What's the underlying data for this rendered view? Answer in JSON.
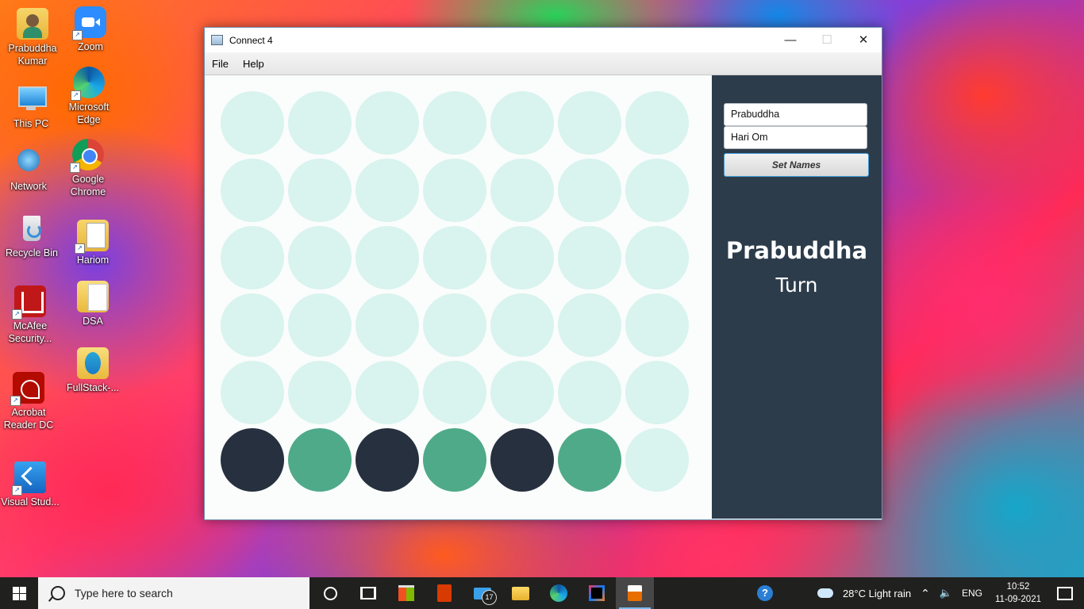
{
  "desktop": {
    "icons": [
      {
        "label": "Prabuddha Kumar"
      },
      {
        "label": "Zoom"
      },
      {
        "label": "This PC"
      },
      {
        "label": "Microsoft Edge"
      },
      {
        "label": "Network"
      },
      {
        "label": "Google Chrome"
      },
      {
        "label": "Recycle Bin"
      },
      {
        "label": "Hariom"
      },
      {
        "label": "McAfee Security..."
      },
      {
        "label": "DSA"
      },
      {
        "label": "Acrobat Reader DC"
      },
      {
        "label": "FullStack-..."
      },
      {
        "label": "Visual Stud..."
      }
    ]
  },
  "window": {
    "title": "Connect 4",
    "controls": {
      "minimize": "—",
      "maximize": "☐",
      "close": "✕"
    },
    "menu": [
      "File",
      "Help"
    ]
  },
  "board": {
    "rows": 6,
    "cols": 7,
    "colors": {
      "empty": "#d9f3ee",
      "player1": "#26303e",
      "player2": "#4faa89"
    },
    "bottom_row": [
      "player1",
      "player2",
      "player1",
      "player2",
      "player1",
      "player2",
      "empty"
    ]
  },
  "side_panel": {
    "player_one_value": "Prabuddha",
    "player_two_value": "Hari Om",
    "set_button": "Set Names",
    "current_player": "Prabuddha",
    "turn_label": "Turn"
  },
  "taskbar": {
    "search_placeholder": "Type here to search",
    "mail_badge": "17",
    "weather": "28°C  Light rain",
    "language": "ENG",
    "time": "10:52",
    "date": "11-09-2021"
  }
}
